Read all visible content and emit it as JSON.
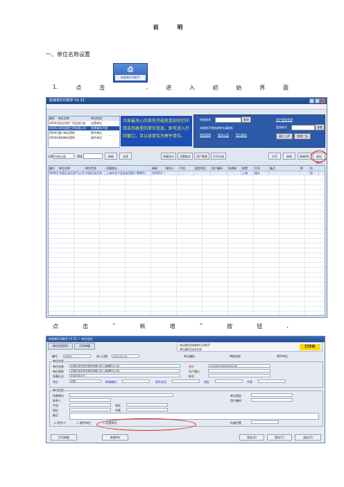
{
  "doc": {
    "title": "说 明",
    "section1": "一、单位名称设置",
    "step1": [
      "1.",
      "点",
      "击",
      ",",
      "进",
      "入",
      "初",
      "始",
      "界",
      "面"
    ],
    "step2": [
      "点",
      "击",
      "“",
      "新",
      "增",
      "”",
      "按",
      "钮",
      ","
    ]
  },
  "icon": {
    "name": "app-shortcut-icon",
    "caption": "快递单打印助手"
  },
  "screen1": {
    "window_title": "快递单打印助手 V1.21",
    "top_grid_headers": [
      "编号",
      "单位名称",
      "单位性质"
    ],
    "top_grid_rows": [
      [
        "00001",
        "西北印钞厂印品发行处",
        "自营单位"
      ],
      [
        "00002",
        "深圳速通工贸有限公司",
        "快递服务代理"
      ],
      [
        "00003",
        "客户单位简称",
        "寄件单位"
      ],
      [
        "00004",
        "其他单位简称",
        "收件单位"
      ]
    ],
    "notice_text": "大家最关心的首先可能就是如何打印 双击列表里的单位信息，即可进入打印窗口，且以该单位为寄件单位。",
    "info": {
      "lbl_search": "快递查询",
      "lbl_note": "如果找不到快递单号请联系",
      "lbl_reg": "用户登录状态",
      "lbl_login": "登录帐号",
      "btn_go": "查询",
      "btn_query": "查看",
      "btn_upload": "图片上传",
      "btn_version": "免费广告",
      "link1": "使用说明",
      "link2": "发布公告",
      "link3": "官方网站"
    },
    "toolbar": {
      "lbl_type": "分类",
      "type_value": "所有记录",
      "lbl_filter": "筛选",
      "btn_refresh": "刷新",
      "btn_all": "全部",
      "btn_single": "单据设计",
      "btn_setfmt": "设置版本",
      "btn_users": "用户管理",
      "btn_printlog": "打印记录",
      "btn_print": "打印",
      "btn_edit": "修改",
      "btn_new": "新增(N)",
      "btn_exit": "退出(Esc)"
    },
    "grid_headers": [
      "编号",
      "单位名称",
      "单位性质",
      "详细地址",
      "邮政",
      "联系人",
      "手机",
      "固定电话",
      "用户编码",
      "快递单",
      "收费",
      "打印",
      "备注",
      "寄",
      "托"
    ],
    "grid_row": [
      "00001",
      "中国石油天然气公司上海…",
      "中国石油天然…",
      "上海市长宁区延安西路二零零号…",
      "200050",
      "",
      "",
      "",
      "",
      "",
      "上海",
      "顺丰",
      "",
      "",
      "是"
    ]
  },
  "screen2": {
    "window_title": "快递单打印助手 V1.21 — 单位信息",
    "tab1": "单位信息(N)",
    "tab2": "打印单据",
    "banner_text": "欢迎使用快递单打印助手",
    "banner_sub": "单位编号自动生成",
    "banner_badge": "打印单",
    "row_no": "编号",
    "row_no_value": "00001",
    "row_date": "录入日期",
    "row_date_value": "2013-02-21",
    "row_code": "单位编码",
    "row_status": "审核状态",
    "row_type": "寄件单位",
    "sect1_cap": "单位信息",
    "f_name": "单位名称",
    "f_name_value": "中国石油天然气股份有限公司上海销售分公司",
    "f_short": "单位简称",
    "f_short_value": "中国石油天然气股份有限公司上海销售分公司",
    "f_group": "所属行业",
    "f_group_value": "石油石化企业",
    "f_addr": "地址",
    "f_addr_value": "中国",
    "f_zip": "邮政编码",
    "f_contact": "联系人",
    "f_phone": "联系电话",
    "f_fax": "传真",
    "f_tax": "税号",
    "f_tax_value": "310000000000000000",
    "f_bank": "开户银行",
    "f_acct": "帐号",
    "f_mail": "邮编",
    "f_region": "地区",
    "sect2_cap": "单位信息",
    "f2_unit": "所属单位",
    "f2_person": "联系人",
    "f2_mobile": "手机",
    "f2_tel": "电话",
    "f2_web": "网址",
    "f2_fax": "传真",
    "f2_type": "单位类型",
    "f2_user": "用户编码",
    "f2_notes": "备注",
    "chk1": "☑ 发件人",
    "chk2": "☐ 收件单位",
    "chk3": "☐ 自营单位",
    "lbl_store": "存放位置",
    "btn_print": "打印单据",
    "btn_new": "新增(N)",
    "btn_save": "保存(S)",
    "btn_save2": "保存(C)",
    "btn_exit": "退出(X)"
  },
  "colors": {
    "accent": "#2c5aa9",
    "notice_bg": "#1a4fb8",
    "notice_text": "#ffe44a",
    "highlight": "#e02020"
  }
}
